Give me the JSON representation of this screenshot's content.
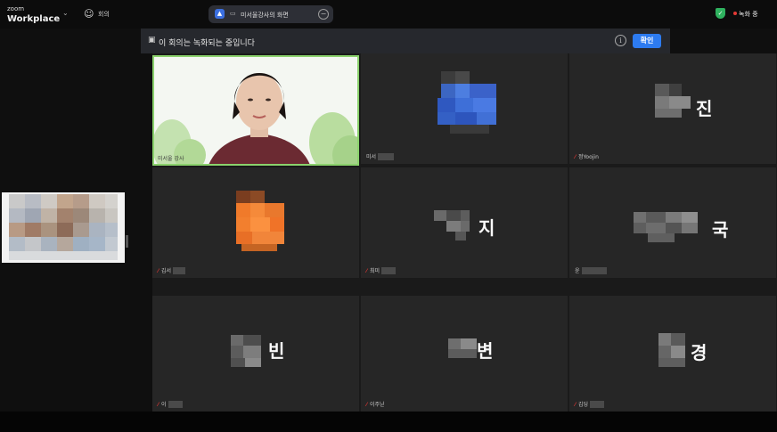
{
  "app": {
    "brand_small": "zoom",
    "brand_big": "Workplace",
    "meeting_label": "회의"
  },
  "share": {
    "label": "미서울강사의 화면"
  },
  "recording": {
    "label": "녹화 중"
  },
  "banner": {
    "text": "이 회의는 녹화되는 중입니다",
    "confirm": "확인"
  },
  "tiles": [
    {
      "name": "미서울 강사",
      "avatar_char": ""
    },
    {
      "name": "미서",
      "avatar_char": ""
    },
    {
      "name": "정Yoojin",
      "avatar_char": "진"
    },
    {
      "name": "김서",
      "avatar_char": ""
    },
    {
      "name": "최미",
      "avatar_char": "지"
    },
    {
      "name": "윤",
      "avatar_char": "국"
    },
    {
      "name": "이",
      "avatar_char": "빈"
    },
    {
      "name": "이주닏",
      "avatar_char": "변"
    },
    {
      "name": "김딩",
      "avatar_char": "경"
    }
  ],
  "colors": {
    "accent": "#2d7bf0",
    "speaker_border": "#8bd26d",
    "mute": "#e53935",
    "shield": "#2fb25f"
  },
  "icons": {
    "logo_chevron": "chevron-down-icon",
    "meeting": "meeting-icon",
    "share": "screen-share-icon",
    "stop": "minus-circle-icon",
    "security": "shield-icon",
    "rec": "recording-dot-icon",
    "info": "info-icon",
    "banner": "recording-notice-icon"
  }
}
